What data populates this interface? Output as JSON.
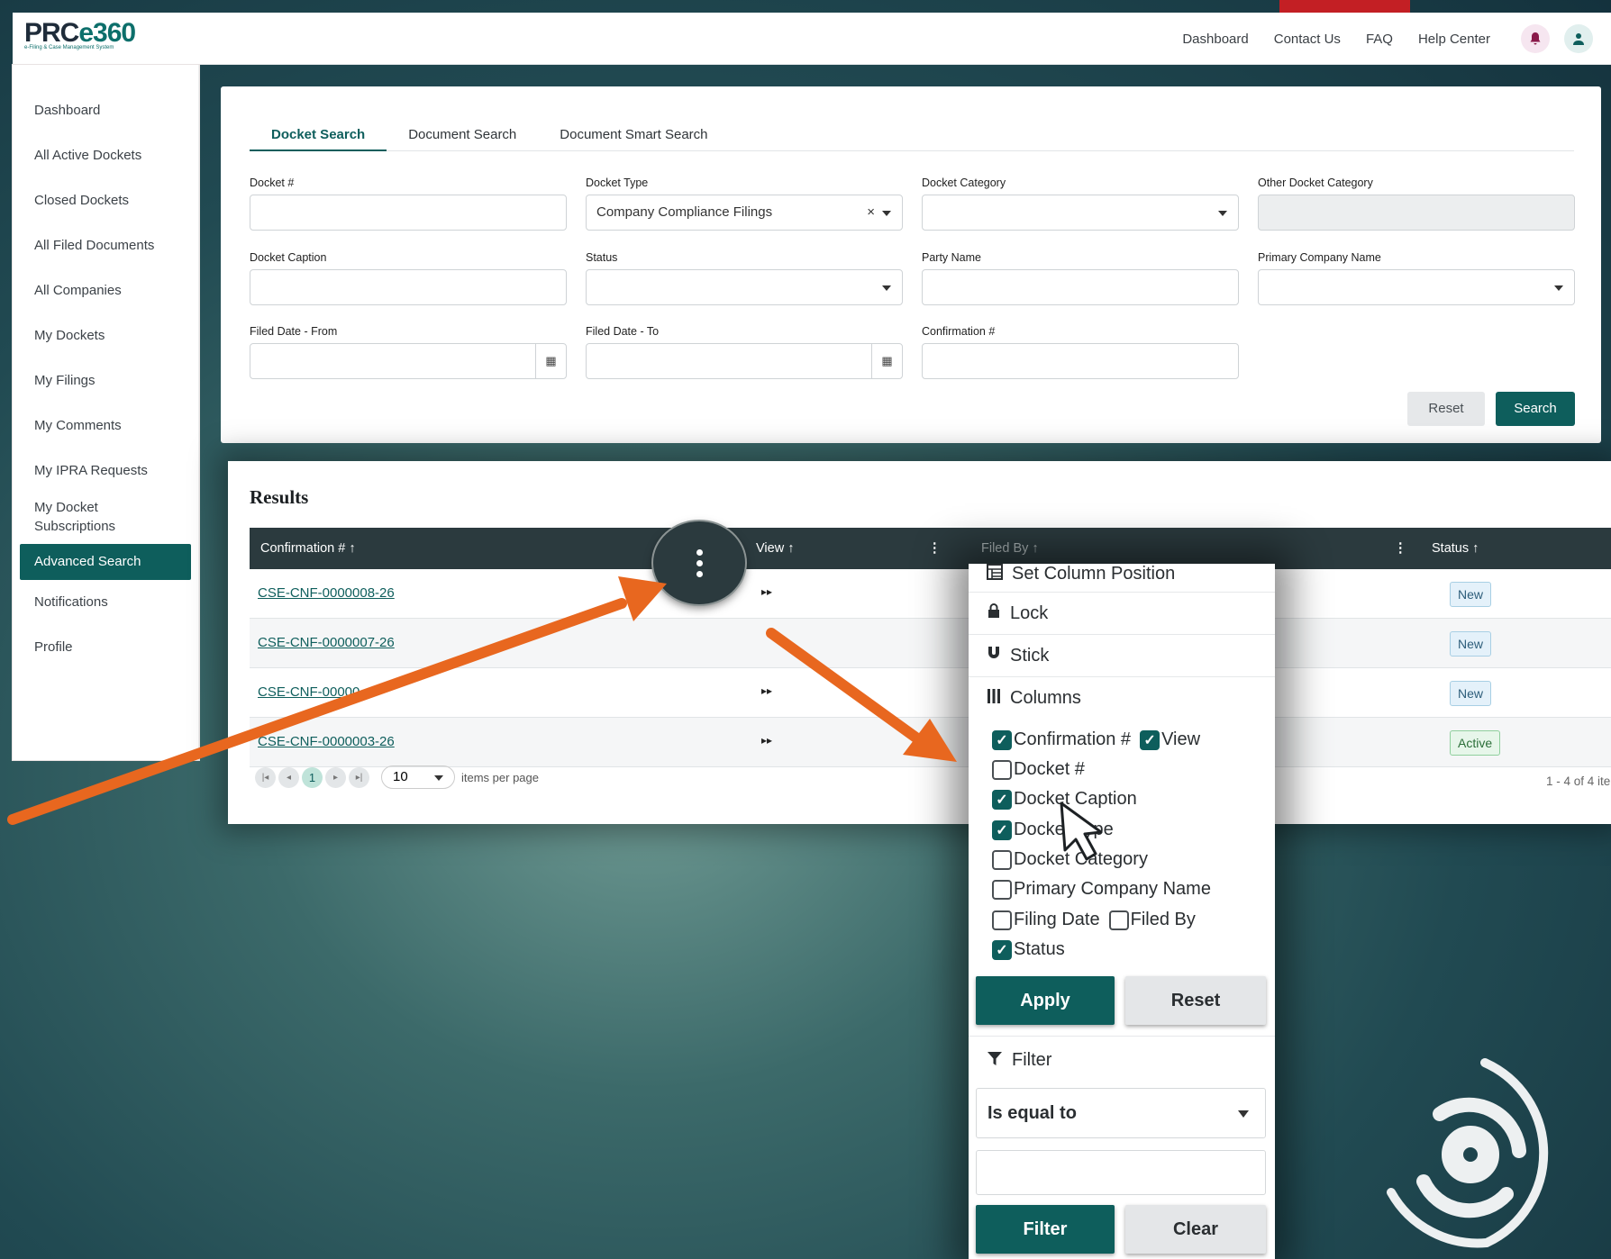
{
  "brand": {
    "logo_text": "PRCe360",
    "logo_sub": "e-Filing & Case Management System"
  },
  "topnav": [
    "Dashboard",
    "Contact Us",
    "FAQ",
    "Help Center"
  ],
  "sidebar": {
    "items": [
      "Dashboard",
      "All Active Dockets",
      "Closed Dockets",
      "All Filed Documents",
      "All Companies",
      "My Dockets",
      "My Filings",
      "My Comments",
      "My IPRA Requests",
      "My Docket Subscriptions",
      "Advanced Search",
      "Notifications",
      "Profile"
    ],
    "active": "Advanced Search"
  },
  "search": {
    "tabs": [
      "Docket Search",
      "Document Search",
      "Document Smart Search"
    ],
    "fields": {
      "docket_no": {
        "label": "Docket #",
        "value": ""
      },
      "docket_type": {
        "label": "Docket Type",
        "value": "Company Compliance Filings",
        "clear": "×"
      },
      "docket_category": {
        "label": "Docket Category",
        "value": ""
      },
      "other_docket_category": {
        "label": "Other Docket Category",
        "value": ""
      },
      "docket_caption": {
        "label": "Docket Caption",
        "value": ""
      },
      "status": {
        "label": "Status",
        "value": ""
      },
      "party_name": {
        "label": "Party Name",
        "value": ""
      },
      "primary_company": {
        "label": "Primary Company Name",
        "value": ""
      },
      "filed_from": {
        "label": "Filed Date - From",
        "value": ""
      },
      "filed_to": {
        "label": "Filed Date - To",
        "value": ""
      },
      "confirmation": {
        "label": "Confirmation #",
        "value": ""
      }
    },
    "reset_label": "Reset",
    "search_label": "Search"
  },
  "results": {
    "title": "Results",
    "columns": {
      "confirmation": "Confirmation # ↑",
      "view": "View ↑",
      "filed_by": "Filed By ↑",
      "status": "Status ↑"
    },
    "rows": [
      {
        "confirmation": "CSE-CNF-0000008-26",
        "status": "New"
      },
      {
        "confirmation": "CSE-CNF-0000007-26",
        "status": "New"
      },
      {
        "confirmation": "CSE-CNF-00000",
        "status": "New"
      },
      {
        "confirmation": "CSE-CNF-0000003-26",
        "status": "Active"
      }
    ],
    "view_icon": "▸▸",
    "pager": {
      "current": "1",
      "per_page": "10",
      "per_page_label": "items per page",
      "count": "1 - 4 of 4 ite"
    }
  },
  "menu": {
    "set_column_position": "Set Column Position",
    "lock": "Lock",
    "stick": "Stick",
    "columns": "Columns",
    "column_options": [
      {
        "label": "Confirmation #",
        "checked": true
      },
      {
        "label": "View",
        "checked": true
      },
      {
        "label": "Docket #",
        "checked": false
      },
      {
        "label": "Docket Caption",
        "checked": true
      },
      {
        "label": "Docket Type",
        "checked": true
      },
      {
        "label": "Docket Category",
        "checked": false
      },
      {
        "label": "Primary Company Name",
        "checked": false
      },
      {
        "label": "Filing Date",
        "checked": false
      },
      {
        "label": "Filed By",
        "checked": false
      },
      {
        "label": "Status",
        "checked": true
      }
    ],
    "apply_label": "Apply",
    "reset_label": "Reset",
    "filter_label": "Filter",
    "operator": "Is equal to",
    "filter_btn": "Filter",
    "clear_btn": "Clear"
  },
  "colors": {
    "teal": "#0e5e5c",
    "header_dark": "#2b3a3e",
    "arrow": "#e8671f"
  }
}
